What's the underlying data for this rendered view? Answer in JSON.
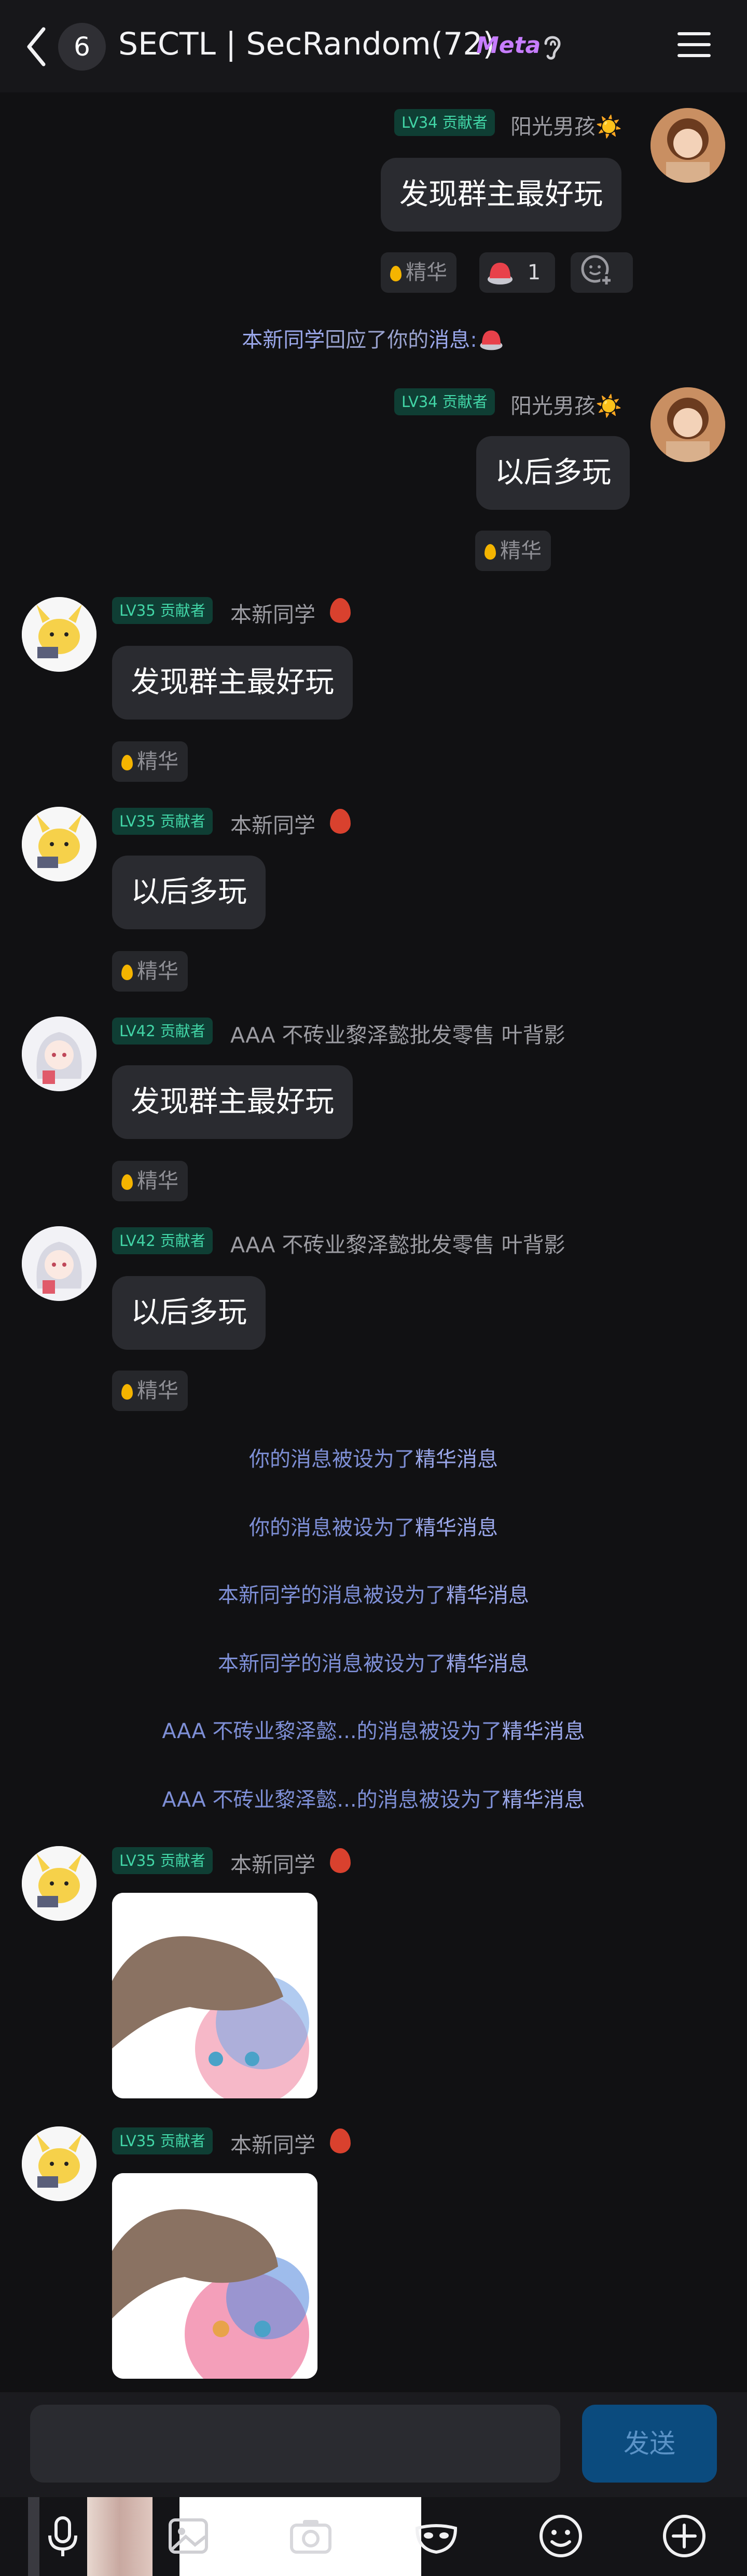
{
  "header": {
    "unread_count": "6",
    "title": "SECTL | SecRandom(72)",
    "meta_badge": "Meta"
  },
  "messages": [
    {
      "level": "LV34 贡献者",
      "name": "阳光男孩☀️",
      "text": "发现群主最好玩",
      "essence": "精华",
      "reaction_count": "1"
    },
    {
      "level": "LV34 贡献者",
      "name": "阳光男孩☀️",
      "text": "以后多玩",
      "essence": "精华"
    },
    {
      "level": "LV35 贡献者",
      "name": "本新同学",
      "text": "发现群主最好玩",
      "essence": "精华"
    },
    {
      "level": "LV35 贡献者",
      "name": "本新同学",
      "text": "以后多玩",
      "essence": "精华"
    },
    {
      "level": "LV42 贡献者",
      "name": "AAA 不砖业黎泽懿批发零售 叶背影",
      "text": "发现群主最好玩",
      "essence": "精华"
    },
    {
      "level": "LV42 贡献者",
      "name": "AAA 不砖业黎泽懿批发零售 叶背影",
      "text": "以后多玩",
      "essence": "精华"
    },
    {
      "level": "LV35 贡献者",
      "name": "本新同学"
    },
    {
      "level": "LV35 贡献者",
      "name": "本新同学"
    }
  ],
  "reply_notice": {
    "user": "本新同学",
    "middle": "回应了你的",
    "link": "消息",
    "tail": ":"
  },
  "system_notices": [
    {
      "prefix": "你的消息被设为了",
      "highlight": "精华消息"
    },
    {
      "prefix": "你的消息被设为了",
      "highlight": "精华消息"
    },
    {
      "prefix": "本新同学的消息被设为了",
      "highlight": "精华消息"
    },
    {
      "prefix": "本新同学的消息被设为了",
      "highlight": "精华消息"
    },
    {
      "prefix": "AAA 不砖业黎泽懿...的消息被设为了",
      "highlight": "精华消息"
    },
    {
      "prefix": "AAA 不砖业黎泽懿...的消息被设为了",
      "highlight": "精华消息"
    }
  ],
  "composer": {
    "send_label": "发送"
  },
  "toolbar": {
    "icons": [
      "mic-icon",
      "photo-icon",
      "camera-icon",
      "mask-icon",
      "emoji-icon",
      "plus-icon"
    ]
  },
  "colors": {
    "level_badge": "#42d6a7",
    "system_text": "#7e8fd6",
    "send_button": "#0b4b7e"
  }
}
